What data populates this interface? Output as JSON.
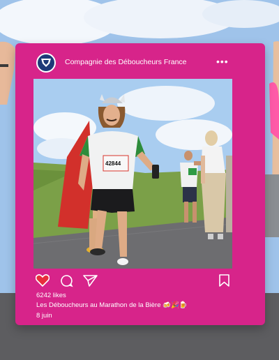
{
  "post": {
    "account_name": "Compagnie des Déboucheurs France",
    "more_icon": "more-dots-icon",
    "avatar_icon": "shield-logo",
    "bib_number": "42844",
    "likes": "6242 likes",
    "caption": "Les Déboucheurs au Marathon de la Bière 🍻🎉🍺",
    "date": "8 juin"
  },
  "icons": [
    "heart-icon",
    "comment-icon",
    "share-icon",
    "bookmark-icon"
  ],
  "colors": {
    "frame": "#d7248a",
    "sky": "#9fc3ea",
    "grass": "#7ba048",
    "road": "#6d6d70"
  }
}
